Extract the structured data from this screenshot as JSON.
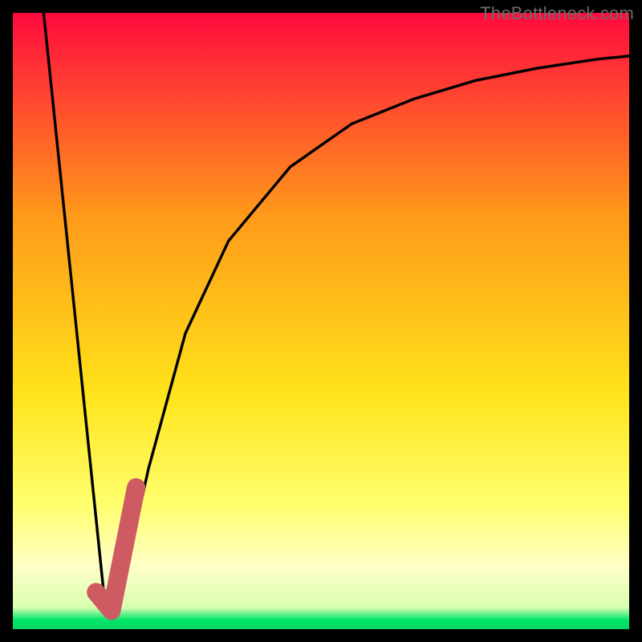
{
  "watermark": {
    "text": "TheBottleneck.com"
  },
  "colors": {
    "background": "#000000",
    "gradient_top": "#ff0a3e",
    "gradient_mid1": "#ff9a1a",
    "gradient_mid2": "#ffe41a",
    "gradient_pale": "#ffffa0",
    "gradient_green": "#00e66a",
    "curve_stroke": "#000000",
    "marker_stroke": "#cf5b62"
  },
  "chart_data": {
    "type": "line",
    "title": "",
    "xlabel": "",
    "ylabel": "",
    "xlim": [
      0,
      100
    ],
    "ylim": [
      0,
      100
    ],
    "series": [
      {
        "name": "falling-line",
        "kind": "line",
        "x": [
          5,
          15
        ],
        "y": [
          100,
          3.5
        ]
      },
      {
        "name": "rising-curve",
        "kind": "curve",
        "x": [
          17,
          22,
          28,
          35,
          45,
          55,
          65,
          75,
          85,
          95,
          100
        ],
        "y": [
          3.5,
          26,
          48,
          63,
          75,
          82,
          86,
          89,
          91,
          92.5,
          93
        ]
      },
      {
        "name": "marker-j",
        "kind": "thick-segment",
        "x": [
          13.5,
          16,
          20
        ],
        "y": [
          6,
          3,
          23
        ]
      }
    ],
    "gradient_stops": [
      {
        "pos": 0.0,
        "color": "#ff0a3e"
      },
      {
        "pos": 0.33,
        "color": "#ff9a1a"
      },
      {
        "pos": 0.62,
        "color": "#ffe41a"
      },
      {
        "pos": 0.8,
        "color": "#ffff70"
      },
      {
        "pos": 0.9,
        "color": "#ffffc8"
      },
      {
        "pos": 0.965,
        "color": "#d8ffb0"
      },
      {
        "pos": 0.985,
        "color": "#00e66a"
      },
      {
        "pos": 1.0,
        "color": "#00d860"
      }
    ]
  }
}
